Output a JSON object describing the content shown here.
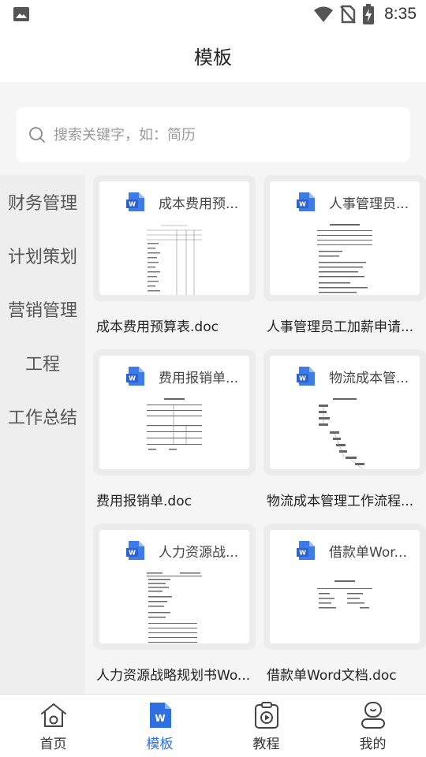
{
  "status": {
    "time": "8:35"
  },
  "header": {
    "title": "模板"
  },
  "search": {
    "placeholder": "搜索关键字，如：简历"
  },
  "categories": [
    "财务管理",
    "计划策划",
    "营销管理",
    "工程",
    "工作总结"
  ],
  "templates": [
    {
      "thumb_title": "成本费用预...",
      "label": "成本费用预算表.doc"
    },
    {
      "thumb_title": "人事管理员...",
      "label": "人事管理员工加薪申请..."
    },
    {
      "thumb_title": "费用报销单...",
      "label": "费用报销单.doc"
    },
    {
      "thumb_title": "物流成本管...",
      "label": "物流成本管理工作流程..."
    },
    {
      "thumb_title": "人力资源战...",
      "label": "人力资源战略规划书Wo..."
    },
    {
      "thumb_title": "借款单Wor...",
      "label": "借款单Word文档.doc"
    }
  ],
  "nav": [
    {
      "label": "首页",
      "icon": "home-icon"
    },
    {
      "label": "模板",
      "icon": "word-doc-icon"
    },
    {
      "label": "教程",
      "icon": "play-video-icon"
    },
    {
      "label": "我的",
      "icon": "profile-icon"
    }
  ],
  "colors": {
    "accent": "#2f6fe4",
    "word_blue": "#3d7be8"
  }
}
